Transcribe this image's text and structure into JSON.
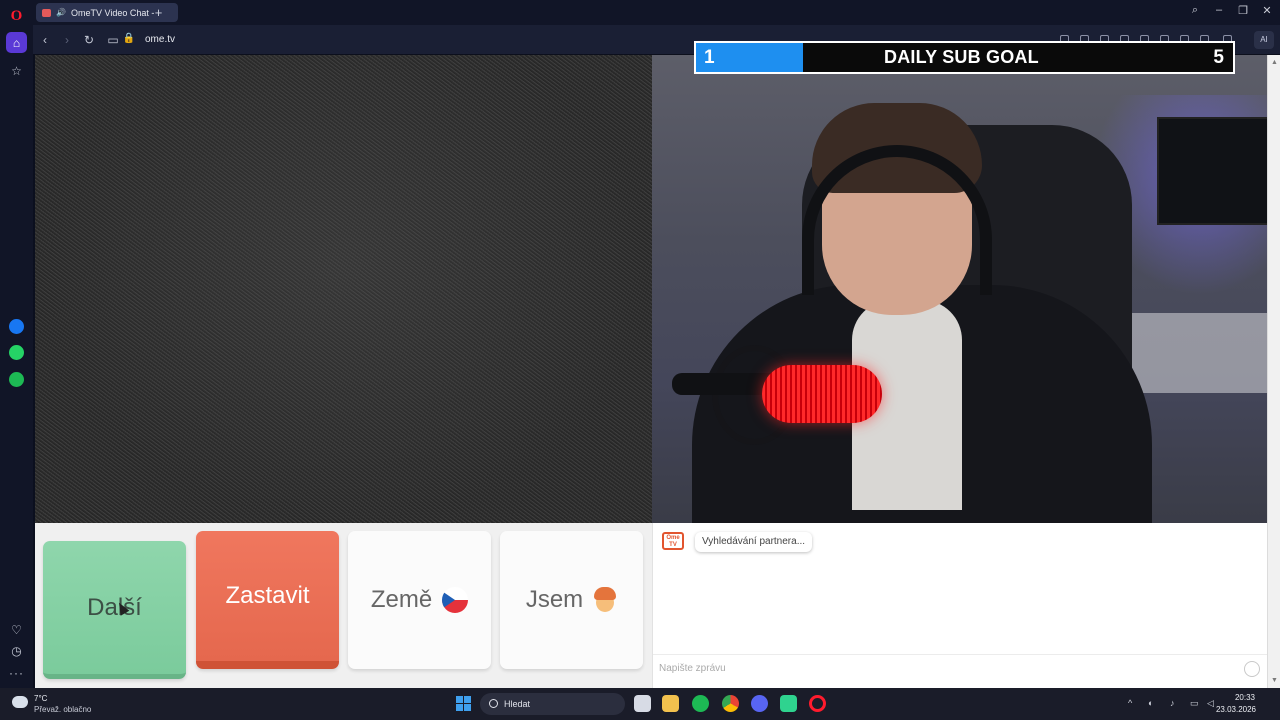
{
  "browser": {
    "tab_title": "OmeTV Video Chat -",
    "new_tab_symbol": "+",
    "url": "ome.tv",
    "ai_label": "AI",
    "sidebar_logo": "O"
  },
  "goal": {
    "current": "1",
    "title": "DAILY SUB GOAL",
    "target": "5",
    "progress_fraction": 0.2,
    "fill_color": "#1e8ff0"
  },
  "controls": {
    "next_label": "Další",
    "stop_label": "Zastavit",
    "country_label": "Země",
    "country_flag": "czech-flag",
    "me_label": "Jsem",
    "me_icon": "boy-face",
    "next_color": "#7bcb9c",
    "stop_color": "#e5684e"
  },
  "chat": {
    "logo_text": "Ome TV",
    "status_message": "Vyhledávání partnera...",
    "input_placeholder": "Napište zprávu"
  },
  "taskbar": {
    "weather_temp": "7°C",
    "weather_desc": "Převaž. oblačno",
    "search_label": "Hledat",
    "time": "20:33",
    "date": "23.03.2026"
  }
}
